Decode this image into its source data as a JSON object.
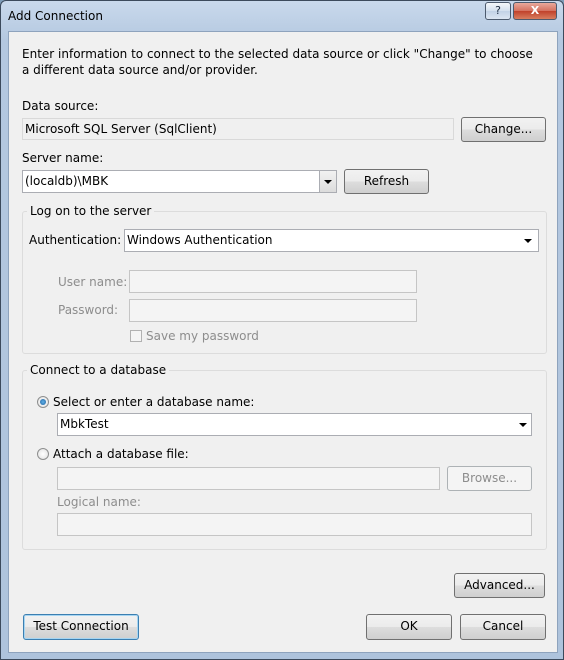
{
  "window": {
    "title": "Add Connection",
    "help_label": "?",
    "close_label": "X"
  },
  "intro": "Enter information to connect to the selected data source or click \"Change\" to choose a different data source and/or provider.",
  "data_source": {
    "label": "Data source:",
    "value": "Microsoft SQL Server (SqlClient)",
    "change_label": "Change..."
  },
  "server": {
    "label": "Server name:",
    "value": "(localdb)\\MBK",
    "refresh_label": "Refresh"
  },
  "logon": {
    "legend": "Log on to the server",
    "auth_label": "Authentication:",
    "auth_value": "Windows Authentication",
    "username_label": "User name:",
    "username_value": "",
    "password_label": "Password:",
    "password_value": "",
    "save_password_label": "Save my password",
    "save_password_checked": false
  },
  "database": {
    "legend": "Connect to a database",
    "select_label": "Select or enter a database name:",
    "select_checked": true,
    "db_name": "MbkTest",
    "attach_label": "Attach a database file:",
    "attach_checked": false,
    "attach_value": "",
    "browse_label": "Browse...",
    "logical_label": "Logical name:",
    "logical_value": ""
  },
  "advanced_label": "Advanced...",
  "footer": {
    "test_label": "Test Connection",
    "ok_label": "OK",
    "cancel_label": "Cancel"
  }
}
